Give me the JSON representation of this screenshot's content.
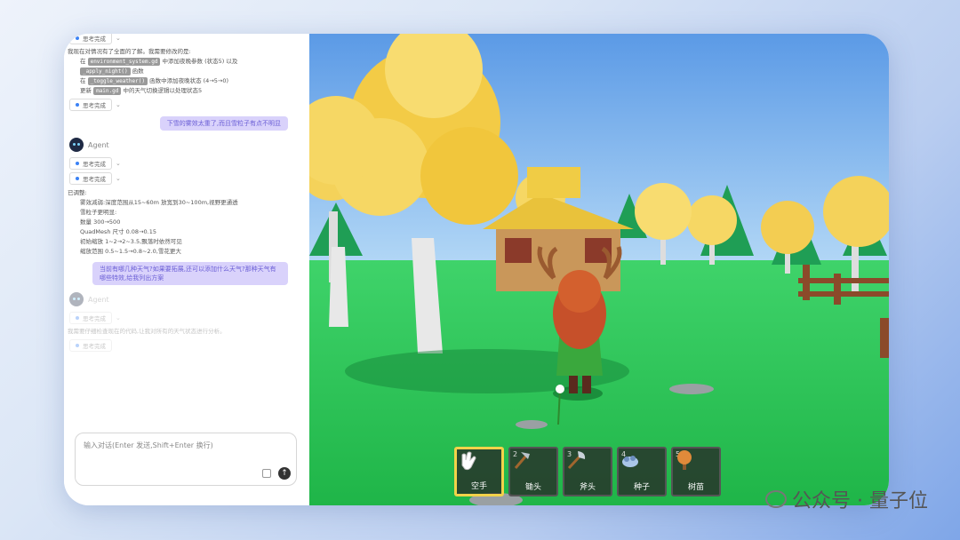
{
  "chat": {
    "think_label": "思考完成",
    "block1": {
      "intro": "我现在对情况有了全面的了解。我需要修改的是:",
      "items": [
        {
          "prefix": "在",
          "code": "environment_system.gd",
          "suffix": "中添加夜晚参数 (状态5) 以及"
        },
        {
          "prefix": "",
          "code": "_apply_night()",
          "suffix": "函数"
        },
        {
          "prefix": "在",
          "code": "_toggle_weather()",
          "suffix": "函数中添加夜晚状态 (4→5→0)"
        },
        {
          "prefix": "更新",
          "code": "main.gd",
          "suffix": "中的天气切换逻辑以处理状态5"
        }
      ]
    },
    "user_msg_1": "下雪的雾效太重了,而且雪粒子有点不明显",
    "agent_name": "Agent",
    "block2": {
      "header": "已调整:",
      "lines": [
        "雾效减弱:深度范围从15~60m 放宽到30~100m,视野更通透",
        "雪粒子更明显:",
        "数量 300→500",
        "QuadMesh 尺寸 0.08→0.15",
        "初始缩放 1~2→2~3.5,飘落时依然可见",
        "缩放范围 0.5~1.5→0.8~2.0,雪花更大"
      ]
    },
    "user_msg_2": "当前有哪几种天气?如果要拓展,还可以添加什么天气?那种天气有哪些特效,给我列出方案",
    "agent_name_2": "Agent",
    "faded_text": "我需要仔细检查现在的代码,让我对所有的天气状态进行分析。",
    "input_placeholder": "输入对话(Enter 发送,Shift+Enter 换行)"
  },
  "hotbar": {
    "slots": [
      {
        "num": "",
        "label": "空手",
        "icon": "hand-icon",
        "active": true
      },
      {
        "num": "2",
        "label": "锄头",
        "icon": "hoe-icon",
        "active": false
      },
      {
        "num": "3",
        "label": "斧头",
        "icon": "axe-icon",
        "active": false
      },
      {
        "num": "4",
        "label": "种子",
        "icon": "seed-icon",
        "active": false
      },
      {
        "num": "5",
        "label": "树苗",
        "icon": "sapling-icon",
        "active": false
      }
    ]
  },
  "watermark": {
    "text": "公众号 · 量子位"
  },
  "colors": {
    "sky": "#6ea9ec",
    "grass": "#2ecb55",
    "tree_yellow": "#f4d25a",
    "user_bubble": "#d9d2fb",
    "hotbar_active": "#f2d24a"
  }
}
